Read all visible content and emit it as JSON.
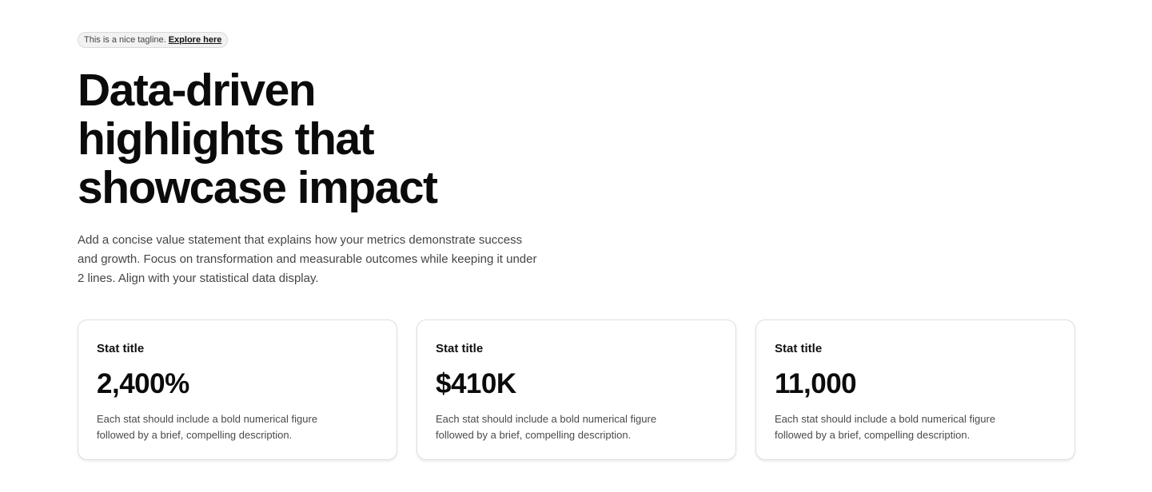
{
  "tagline": {
    "text": "This is a nice tagline.",
    "link_label": "Explore here"
  },
  "hero": {
    "headline": "Data-driven highlights that showcase impact",
    "value_statement": "Add a concise value statement that explains how your metrics demonstrate success and growth. Focus on transformation and measurable outcomes while keeping it under 2 lines. Align with your statistical data display."
  },
  "stats": [
    {
      "title": "Stat title",
      "value": "2,400%",
      "description": "Each stat should include a bold numerical figure followed by a brief, compelling description."
    },
    {
      "title": "Stat title",
      "value": "$410K",
      "description": "Each stat should include a bold numerical figure followed by a brief, compelling description."
    },
    {
      "title": "Stat title",
      "value": "11,000",
      "description": "Each stat should include a bold numerical figure followed by a brief, compelling description."
    }
  ],
  "colors": {
    "text_primary": "#111111",
    "text_secondary": "#454545",
    "card_border": "#dedede",
    "tagline_background": "#f2f2f2"
  }
}
